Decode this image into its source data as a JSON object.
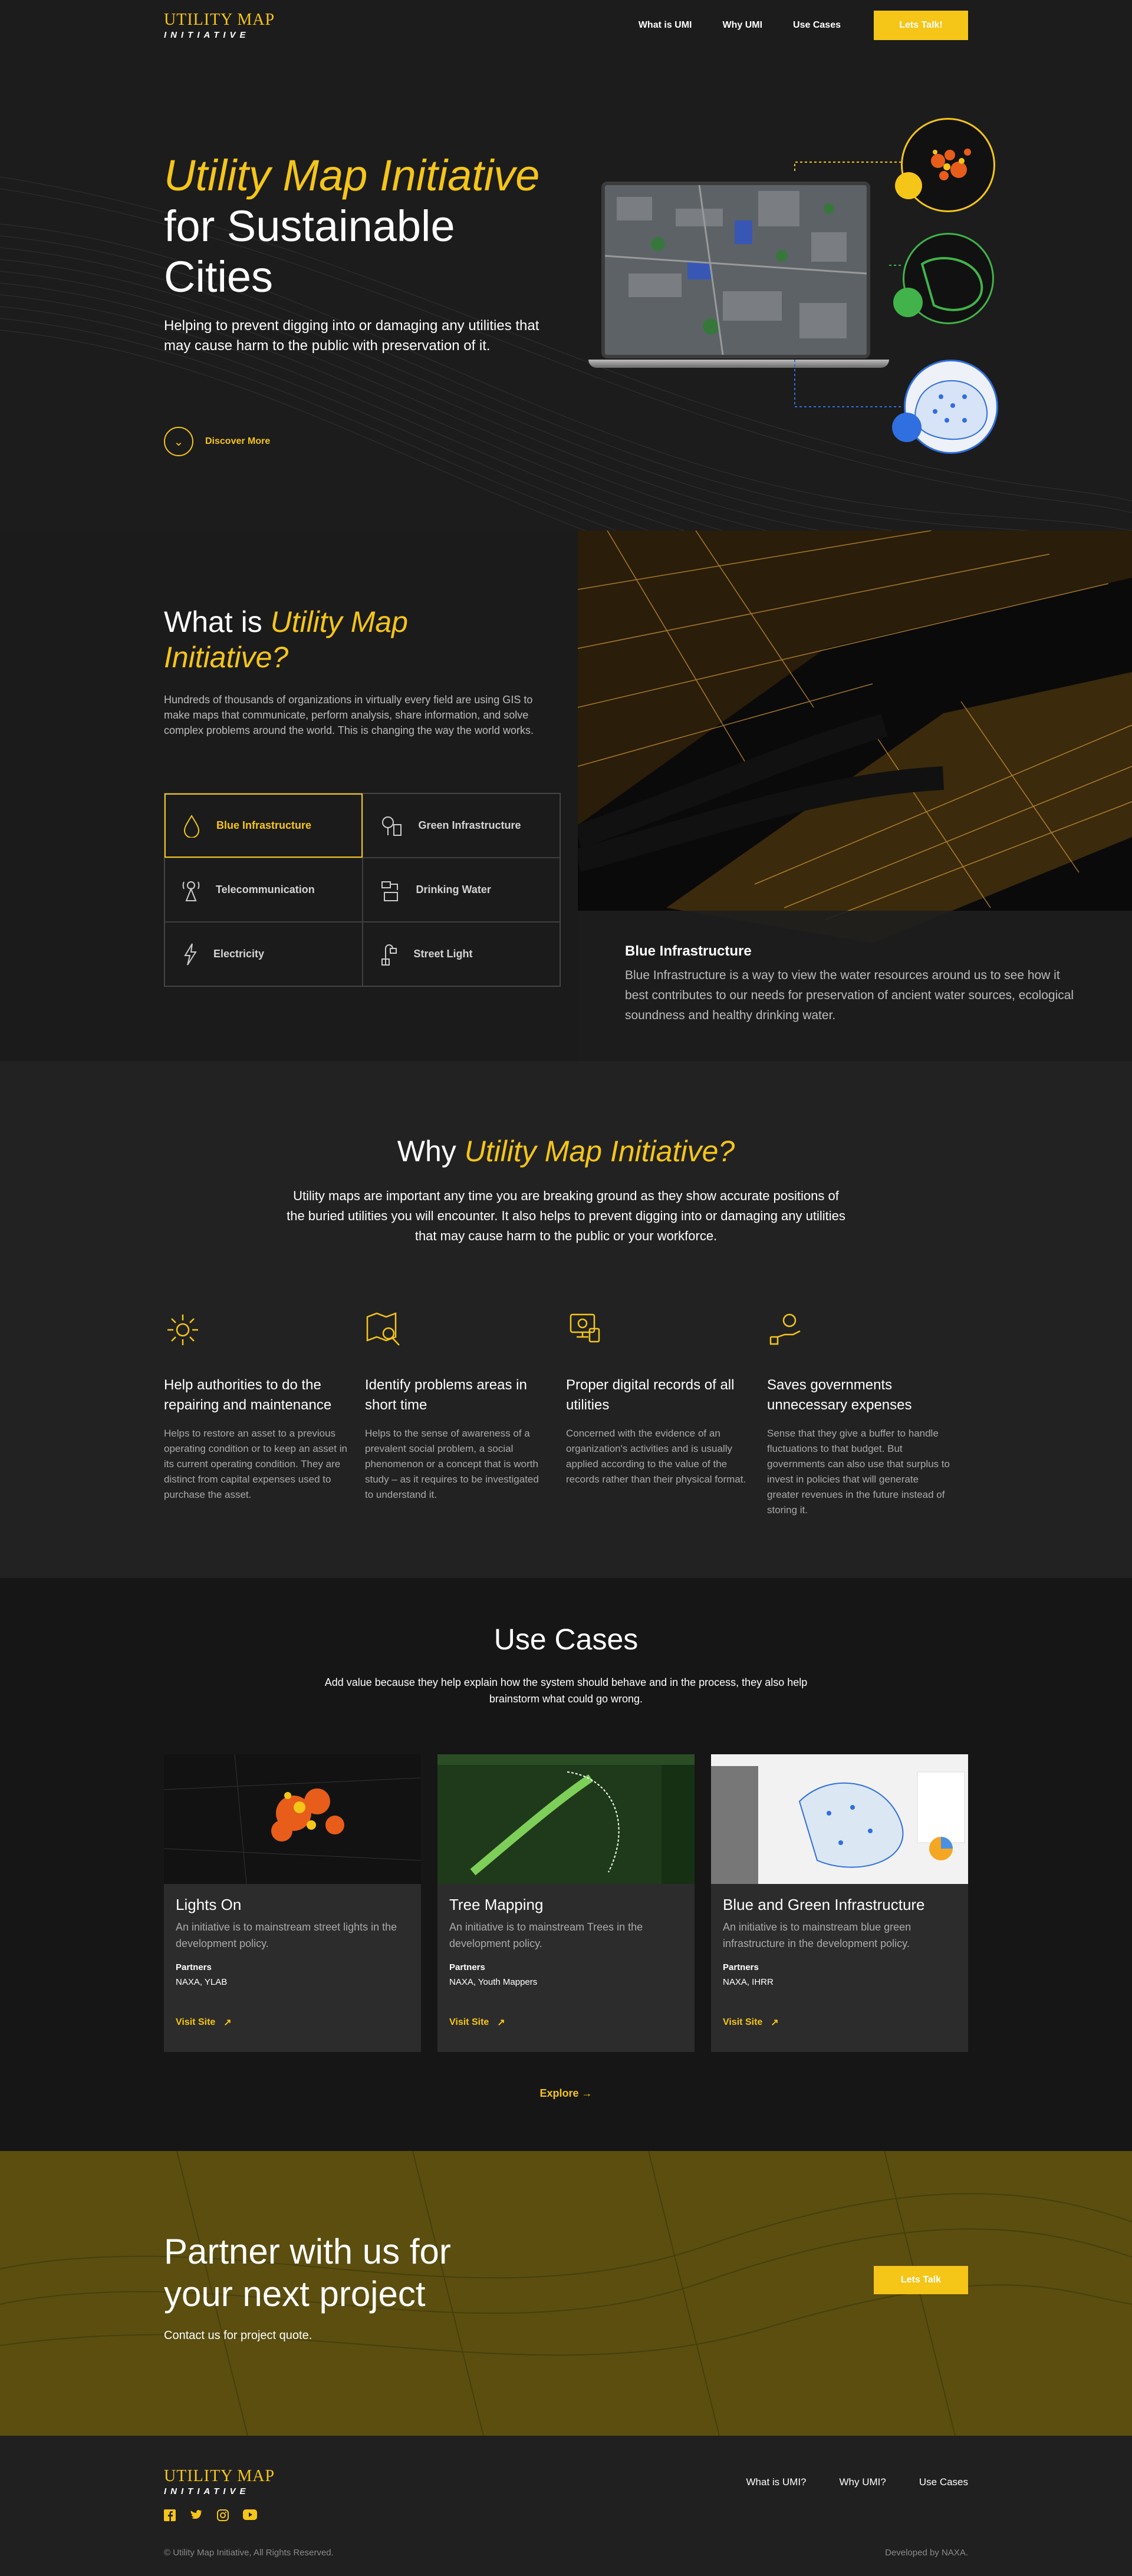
{
  "header": {
    "logo_line1": "UTILITY MAP",
    "logo_line2": "INITIATIVE",
    "nav": [
      "What is UMI",
      "Why UMI",
      "Use Cases"
    ],
    "cta": "Lets Talk!"
  },
  "hero": {
    "title_accent": "Utility Map Initiative",
    "title_line2": "for Sustainable",
    "title_line3": "Cities",
    "lead": "Helping to prevent digging into or damaging any utilities that may cause harm to the public with preservation of it.",
    "discover": "Discover More"
  },
  "what": {
    "title_plain": "What is ",
    "title_accent": "Utility Map Initiative?",
    "description": "Hundreds of thousands of organizations in virtually every field are using GIS to make maps that communicate, perform analysis, share information, and solve complex problems around the world. This is changing the way the world works.",
    "categories": [
      {
        "label": "Blue Infrastructure",
        "icon": "drop-icon"
      },
      {
        "label": "Green Infrastructure",
        "icon": "tree-icon"
      },
      {
        "label": "Telecommunication",
        "icon": "tower-icon"
      },
      {
        "label": "Drinking Water",
        "icon": "tap-icon"
      },
      {
        "label": "Electricity",
        "icon": "lightning-icon"
      },
      {
        "label": "Street Light",
        "icon": "street-light-icon"
      }
    ],
    "panel_title": "Blue Infrastructure",
    "panel_text": "Blue Infrastructure is a way to view the water resources around us to see how it best contributes to our needs for preservation of ancient water sources, ecological soundness and healthy drinking water."
  },
  "why": {
    "title_plain": "Why ",
    "title_accent": "Utility Map Initiative?",
    "description": "Utility maps are important any time you are breaking ground as they show accurate positions of the buried utilities you will encounter. It also helps to prevent digging into or damaging any utilities that may cause harm to the public or your workforce.",
    "features": [
      {
        "title": "Help authorities to do the repairing and maintenance",
        "text": "Helps to restore an asset to a previous operating condition or to keep an asset in its current operating condition. They are distinct from capital expenses used to purchase the asset."
      },
      {
        "title": "Identify problems areas in short time",
        "text": "Helps to the sense of awareness of a prevalent social problem, a social phenomenon or a concept that is worth study – as it requires to be investigated to understand it."
      },
      {
        "title": "Proper digital records of all utilities",
        "text": "Concerned with the evidence of an organization's activities and is usually applied according to the value of the records rather than their physical format."
      },
      {
        "title": "Saves governments unnecessary expenses",
        "text": "Sense that they give a buffer to handle fluctuations to that budget. But governments can also use that surplus to invest in policies that will generate greater revenues in the future instead of storing it."
      }
    ]
  },
  "uses": {
    "title": "Use Cases",
    "description": "Add value because they help explain how the system should behave and in the process, they also help brainstorm what could go wrong.",
    "cards": [
      {
        "title": "Lights On",
        "text": "An initiative is to mainstream street lights in the development policy.",
        "partners_label": "Partners",
        "partners": "NAXA, YLAB",
        "link": "Visit Site",
        "thumb_title": "Lights On"
      },
      {
        "title": "Tree Mapping",
        "text": "An initiative is to mainstream Trees  in the development policy.",
        "partners_label": "Partners",
        "partners": "NAXA, Youth Mappers",
        "link": "Visit Site",
        "thumb_title": "Tree Mapping"
      },
      {
        "title": "Blue and Green Infrastructure",
        "text": "An initiative is to mainstream blue green infrastructure in the development policy.",
        "partners_label": "Partners",
        "partners": "NAXA, IHRR",
        "link": "Visit Site",
        "thumb_title": "Blue and Green Infrastructure"
      }
    ],
    "explore": "Explore"
  },
  "partner": {
    "title": "Partner with us for your next project",
    "text": "Contact us for project quote.",
    "cta": "Lets Talk"
  },
  "footer": {
    "logo_line1": "UTILITY MAP",
    "logo_line2": "INITIATIVE",
    "nav": [
      "What is UMI?",
      "Why UMI?",
      "Use Cases"
    ],
    "social": [
      "facebook-icon",
      "twitter-icon",
      "instagram-icon",
      "youtube-icon"
    ],
    "copyright": "© Utility Map Initiative, All Rights Reserved.",
    "developed": "Developed by NAXA."
  },
  "colors": {
    "accent": "#f5c518",
    "background": "#1e1e1e"
  }
}
